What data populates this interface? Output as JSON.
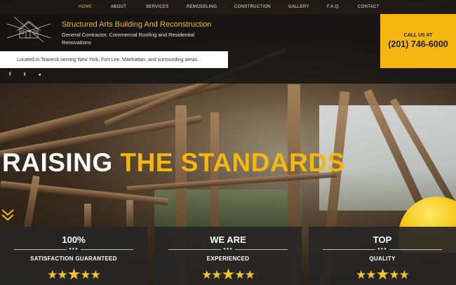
{
  "nav": {
    "items": [
      {
        "label": "HOME",
        "active": true
      },
      {
        "label": "ABOUT",
        "active": false
      },
      {
        "label": "SERVICES",
        "active": false
      },
      {
        "label": "REMODELING",
        "active": false
      },
      {
        "label": "CONSTRUCTION",
        "active": false
      },
      {
        "label": "GALLERY",
        "active": false
      },
      {
        "label": "F.A.Q.",
        "active": false
      },
      {
        "label": "CONTACT",
        "active": false
      }
    ]
  },
  "header": {
    "title": "Structured Arts Building And Reconstruction",
    "subtitle": "General Contractor, Commercial Roofing and Residential Renovations",
    "location": "Located in Teaneck serving New York, Fort Lee, Manhattan, and surrounding areas."
  },
  "call": {
    "label": "CALL US AT",
    "phone": "(201) 746-6000"
  },
  "social": {
    "icons": [
      {
        "name": "facebook-icon",
        "glyph": "f"
      },
      {
        "name": "twitter-icon",
        "glyph": "t"
      },
      {
        "name": "map-pin-icon",
        "glyph": "●"
      }
    ]
  },
  "hero": {
    "headline_white": "RAISING",
    "headline_yellow": "THE STANDARDS"
  },
  "cards": [
    {
      "title": "100%",
      "subtitle": "SATISFACTION GUARANTEED",
      "stars": 5
    },
    {
      "title": "WE ARE",
      "subtitle": "EXPERIENCED",
      "stars": 5
    },
    {
      "title": "TOP",
      "subtitle": "QUALITY",
      "stars": 5
    }
  ],
  "colors": {
    "accent": "#f5b70f",
    "header_bg": "#121212",
    "card_bg": "#262626"
  }
}
